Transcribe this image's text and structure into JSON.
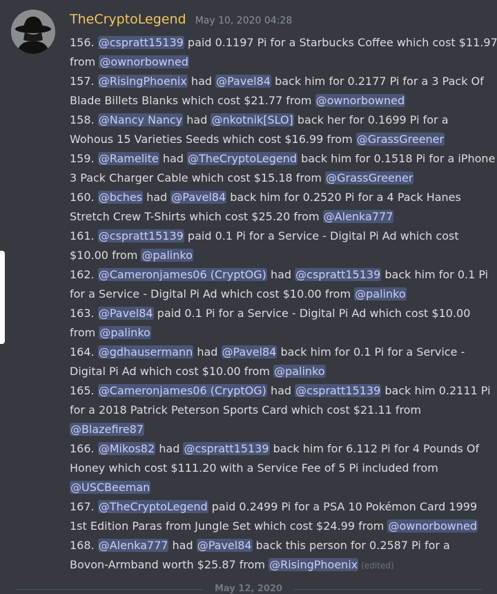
{
  "message": {
    "username": "TheCryptoLegend",
    "timestamp": "May 10, 2020 04:28",
    "edited_label": "(edited)",
    "lines": [
      [
        {
          "t": "156. "
        },
        {
          "m": "@cspratt15139"
        },
        {
          "t": " paid 0.1197 Pi for a Starbucks Coffee which cost $11.97"
        }
      ],
      [
        {
          "t": "from "
        },
        {
          "m": "@ownorbowned"
        }
      ],
      [
        {
          "t": "157. "
        },
        {
          "m": "@RisingPhoenix"
        },
        {
          "t": " had "
        },
        {
          "m": "@Pavel84"
        },
        {
          "t": " back him for 0.2177 Pi for a 3 Pack Of"
        }
      ],
      [
        {
          "t": "Blade Billets Blanks which cost $21.77 from "
        },
        {
          "m": "@ownorbowned"
        }
      ],
      [
        {
          "t": "158. "
        },
        {
          "m": "@Nancy Nancy"
        },
        {
          "t": " had "
        },
        {
          "m": "@nkotnik[SLO]"
        },
        {
          "t": " back her for 0.1699 Pi for a"
        }
      ],
      [
        {
          "t": "Wohous 15 Varieties Seeds which cost $16.99 from "
        },
        {
          "m": "@GrassGreener"
        }
      ],
      [
        {
          "t": "159. "
        },
        {
          "m": "@Ramelite"
        },
        {
          "t": " had "
        },
        {
          "m": "@TheCryptoLegend"
        },
        {
          "t": " back him for 0.1518 Pi for a iPhone"
        }
      ],
      [
        {
          "t": "3 Pack Charger Cable which cost $15.18 from "
        },
        {
          "m": "@GrassGreener"
        }
      ],
      [
        {
          "t": "160. "
        },
        {
          "m": "@bches"
        },
        {
          "t": " had "
        },
        {
          "m": "@Pavel84"
        },
        {
          "t": " back him for 0.2520 Pi for a 4 Pack Hanes"
        }
      ],
      [
        {
          "t": "Stretch Crew T-Shirts which cost $25.20 from "
        },
        {
          "m": "@Alenka777"
        }
      ],
      [
        {
          "t": "161. "
        },
        {
          "m": "@cspratt15139"
        },
        {
          "t": " paid 0.1 Pi for a Service - Digital Pi Ad which cost"
        }
      ],
      [
        {
          "t": "$10.00 from "
        },
        {
          "m": "@palinko"
        }
      ],
      [
        {
          "t": "162. "
        },
        {
          "m": "@Cameronjames06 (CryptOG)"
        },
        {
          "t": " had "
        },
        {
          "m": "@cspratt15139"
        },
        {
          "t": " back him for 0.1 Pi"
        }
      ],
      [
        {
          "t": "for a Service - Digital Pi Ad which cost $10.00 from "
        },
        {
          "m": "@palinko"
        }
      ],
      [
        {
          "t": "163. "
        },
        {
          "m": "@Pavel84"
        },
        {
          "t": " paid 0.1 Pi for a Service - Digital Pi Ad which cost $10.00"
        }
      ],
      [
        {
          "t": "from "
        },
        {
          "m": "@palinko"
        }
      ],
      [
        {
          "t": "164. "
        },
        {
          "m": "@gdhausermann"
        },
        {
          "t": " had "
        },
        {
          "m": "@Pavel84"
        },
        {
          "t": " back him for 0.1 Pi for a Service -"
        }
      ],
      [
        {
          "t": "Digital Pi Ad which cost $10.00 from "
        },
        {
          "m": "@palinko"
        }
      ],
      [
        {
          "t": "165. "
        },
        {
          "m": "@Cameronjames06 (CryptOG)"
        },
        {
          "t": " had "
        },
        {
          "m": "@cspratt15139"
        },
        {
          "t": " back him 0.2111 Pi"
        }
      ],
      [
        {
          "t": "for a 2018 Patrick Peterson Sports Card which cost $21.11 from"
        }
      ],
      [
        {
          "m": "@Blazefire87"
        }
      ],
      [
        {
          "t": "166. "
        },
        {
          "m": "@Mikos82"
        },
        {
          "t": " had "
        },
        {
          "m": "@cspratt15139"
        },
        {
          "t": " back him for 6.112 Pi for 4 Pounds Of"
        }
      ],
      [
        {
          "t": "Honey which cost $111.20 with a Service Fee of 5 Pi included from"
        }
      ],
      [
        {
          "m": "@USCBeeman"
        }
      ],
      [
        {
          "t": "167. "
        },
        {
          "m": "@TheCryptoLegend"
        },
        {
          "t": " paid 0.2499 Pi for a PSA 10 Pokémon Card 1999"
        }
      ],
      [
        {
          "t": "1st Edition Paras from Jungle Set which cost $24.99 from "
        },
        {
          "m": "@ownorbowned"
        }
      ],
      [
        {
          "t": "168. "
        },
        {
          "m": "@Alenka777"
        },
        {
          "t": " had "
        },
        {
          "m": "@Pavel84"
        },
        {
          "t": " back this person for 0.2587 Pi for a"
        }
      ],
      [
        {
          "t": "Bovon-Armband worth $25.87 from "
        },
        {
          "m": "@RisingPhoenix"
        },
        {
          "e": true
        }
      ]
    ]
  },
  "date_divider": "May 12, 2020",
  "colors": {
    "background": "#36393f",
    "username": "#f4c65e",
    "mention_text": "#c9cdfb",
    "mention_bg": "rgba(114,137,218,0.35)",
    "body_text": "#dcddde"
  }
}
